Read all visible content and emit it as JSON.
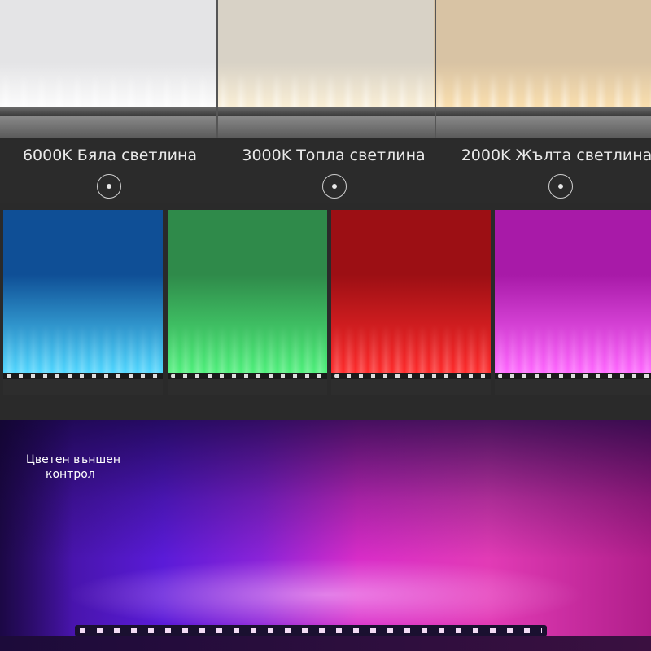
{
  "temperatures": [
    {
      "label": "6000K Бяла светлина",
      "wall": "#e4e4e6",
      "glow": "#ffffff"
    },
    {
      "label": "3000K Топла светлина",
      "wall": "#d8d2c6",
      "glow": "#fff3d8"
    },
    {
      "label": "2000K Жълта светлина",
      "wall": "#d8c3a4",
      "glow": "#ffe3b0"
    }
  ],
  "colors": [
    {
      "name": "blue",
      "top": "#0f4f96",
      "bottom": "#4fd7ff"
    },
    {
      "name": "green",
      "top": "#2f8a4a",
      "bottom": "#4df07a"
    },
    {
      "name": "red",
      "top": "#9c0f14",
      "bottom": "#ff2a2a"
    },
    {
      "name": "magenta",
      "top": "#a81aa8",
      "bottom": "#ff66ff"
    }
  ],
  "bottom": {
    "label_line1": "Цветен външен",
    "label_line2": "контрол"
  }
}
